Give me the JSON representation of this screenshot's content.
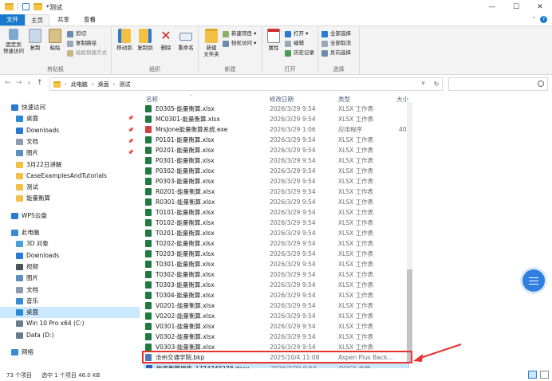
{
  "window": {
    "title": "测试"
  },
  "ribbon_tabs": [
    "文件",
    "主页",
    "共享",
    "查看"
  ],
  "ribbon": {
    "clipboard": {
      "label": "剪贴板",
      "pin": "固定到\n快速访问",
      "copy": "复制",
      "paste": "粘贴",
      "cut": "剪切",
      "copy_path": "复制路径",
      "paste_shortcut": "粘贴快捷方式"
    },
    "organize": {
      "label": "组织",
      "move_to": "移动到",
      "copy_to": "复制到",
      "delete": "删除",
      "rename": "重命名"
    },
    "new": {
      "label": "新建",
      "new_folder": "新建\n文件夹",
      "new_item": "新建项目 ▾",
      "easy_access": "轻松访问 ▾"
    },
    "open": {
      "label": "打开",
      "properties": "属性",
      "open": "打开 ▾",
      "edit": "编辑",
      "history": "历史记录"
    },
    "select": {
      "label": "选择",
      "select_all": "全部选择",
      "select_none": "全部取消",
      "invert": "反向选择"
    }
  },
  "address": {
    "parts": [
      "此电脑",
      "桌面",
      "测试"
    ]
  },
  "search": {
    "placeholder": ""
  },
  "nav": [
    {
      "label": "快速访问",
      "icon": "star-icon",
      "color": "#2a7ad5",
      "pinned": false,
      "level": 0
    },
    {
      "label": "桌面",
      "icon": "desktop-icon",
      "color": "#2a8ad5",
      "pinned": true,
      "level": 1
    },
    {
      "label": "Downloads",
      "icon": "download-icon",
      "color": "#2a7ad5",
      "pinned": true,
      "level": 1
    },
    {
      "label": "文档",
      "icon": "document-icon",
      "color": "#8a9bb0",
      "pinned": true,
      "level": 1
    },
    {
      "label": "图片",
      "icon": "picture-icon",
      "color": "#5a8fc0",
      "pinned": true,
      "level": 1
    },
    {
      "label": "3月22日讲解",
      "icon": "folder-icon",
      "color": "#f2c045",
      "pinned": false,
      "level": 1
    },
    {
      "label": "CaseExamplesAndTutorials",
      "icon": "folder-icon",
      "color": "#f2c045",
      "pinned": false,
      "level": 1
    },
    {
      "label": "测试",
      "icon": "folder-icon",
      "color": "#f2c045",
      "pinned": false,
      "level": 1
    },
    {
      "label": "能量衡算",
      "icon": "folder-icon",
      "color": "#f2c045",
      "pinned": false,
      "level": 1
    },
    {
      "label": "",
      "spacer": true
    },
    {
      "label": "WPS云盘",
      "icon": "cloud-icon",
      "color": "#2a7ad5",
      "pinned": false,
      "level": 0
    },
    {
      "label": "",
      "spacer": true
    },
    {
      "label": "此电脑",
      "icon": "computer-icon",
      "color": "#3a8ad5",
      "pinned": false,
      "level": 0
    },
    {
      "label": "3D 对象",
      "icon": "3d-objects-icon",
      "color": "#4aa0d8",
      "pinned": false,
      "level": 1
    },
    {
      "label": "Downloads",
      "icon": "download-icon",
      "color": "#2a7ad5",
      "pinned": false,
      "level": 1
    },
    {
      "label": "视频",
      "icon": "video-icon",
      "color": "#4a5060",
      "pinned": false,
      "level": 1
    },
    {
      "label": "图片",
      "icon": "picture-icon",
      "color": "#5a8fc0",
      "pinned": false,
      "level": 1
    },
    {
      "label": "文档",
      "icon": "document-icon",
      "color": "#8a9bb0",
      "pinned": false,
      "level": 1
    },
    {
      "label": "音乐",
      "icon": "music-icon",
      "color": "#3a8ad5",
      "pinned": false,
      "level": 1
    },
    {
      "label": "桌面",
      "icon": "desktop-icon",
      "color": "#2a8ad5",
      "pinned": false,
      "level": 1,
      "selected": true
    },
    {
      "label": "Win 10 Pro x64 (C:)",
      "icon": "drive-icon",
      "color": "#6a7a8a",
      "pinned": false,
      "level": 1
    },
    {
      "label": "Data (D:)",
      "icon": "drive-icon",
      "color": "#6a7a8a",
      "pinned": false,
      "level": 1
    },
    {
      "label": "",
      "spacer": true
    },
    {
      "label": "网络",
      "icon": "network-icon",
      "color": "#3a8ad5",
      "pinned": false,
      "level": 0
    }
  ],
  "columns": {
    "name": "名称",
    "date": "修改日期",
    "type": "类型",
    "size": "大小"
  },
  "files": [
    {
      "name": "E0305-能量衡算.xlsx",
      "date": "2026/3/29 9:54",
      "type": "XLSX 工作表",
      "size": "",
      "icon": "xlsx-icon"
    },
    {
      "name": "MC0301-能量衡算.xlsx",
      "date": "2026/3/29 9:54",
      "type": "XLSX 工作表",
      "size": "",
      "icon": "xlsx-icon"
    },
    {
      "name": "MrsJone能量衡算系统.exe",
      "date": "2026/3/29 1:06",
      "type": "应用程序",
      "size": "40,",
      "icon": "exe-icon"
    },
    {
      "name": "P0101-能量衡算.xlsx",
      "date": "2026/3/29 9:54",
      "type": "XLSX 工作表",
      "size": "",
      "icon": "xlsx-icon"
    },
    {
      "name": "P0201-能量衡算.xlsx",
      "date": "2026/3/29 9:54",
      "type": "XLSX 工作表",
      "size": "",
      "icon": "xlsx-icon"
    },
    {
      "name": "P0301-能量衡算.xlsx",
      "date": "2026/3/29 9:54",
      "type": "XLSX 工作表",
      "size": "",
      "icon": "xlsx-icon"
    },
    {
      "name": "P0302-能量衡算.xlsx",
      "date": "2026/3/29 9:54",
      "type": "XLSX 工作表",
      "size": "",
      "icon": "xlsx-icon"
    },
    {
      "name": "P0303-能量衡算.xlsx",
      "date": "2026/3/29 9:54",
      "type": "XLSX 工作表",
      "size": "",
      "icon": "xlsx-icon"
    },
    {
      "name": "R0201-能量衡算.xlsx",
      "date": "2026/3/29 9:54",
      "type": "XLSX 工作表",
      "size": "",
      "icon": "xlsx-icon"
    },
    {
      "name": "R0301-能量衡算.xlsx",
      "date": "2026/3/29 9:54",
      "type": "XLSX 工作表",
      "size": "",
      "icon": "xlsx-icon"
    },
    {
      "name": "T0101-能量衡算.xlsx",
      "date": "2026/3/29 9:54",
      "type": "XLSX 工作表",
      "size": "",
      "icon": "xlsx-icon"
    },
    {
      "name": "T0102-能量衡算.xlsx",
      "date": "2026/3/29 9:54",
      "type": "XLSX 工作表",
      "size": "",
      "icon": "xlsx-icon"
    },
    {
      "name": "T0201-能量衡算.xlsx",
      "date": "2026/3/29 9:54",
      "type": "XLSX 工作表",
      "size": "",
      "icon": "xlsx-icon"
    },
    {
      "name": "T0202-能量衡算.xlsx",
      "date": "2026/3/29 9:54",
      "type": "XLSX 工作表",
      "size": "",
      "icon": "xlsx-icon"
    },
    {
      "name": "T0203-能量衡算.xlsx",
      "date": "2026/3/29 9:54",
      "type": "XLSX 工作表",
      "size": "",
      "icon": "xlsx-icon"
    },
    {
      "name": "T0301-能量衡算.xlsx",
      "date": "2026/3/29 9:54",
      "type": "XLSX 工作表",
      "size": "",
      "icon": "xlsx-icon"
    },
    {
      "name": "T0302-能量衡算.xlsx",
      "date": "2026/3/29 9:54",
      "type": "XLSX 工作表",
      "size": "",
      "icon": "xlsx-icon"
    },
    {
      "name": "T0303-能量衡算.xlsx",
      "date": "2026/3/29 9:54",
      "type": "XLSX 工作表",
      "size": "",
      "icon": "xlsx-icon"
    },
    {
      "name": "T0304-能量衡算.xlsx",
      "date": "2026/3/29 9:54",
      "type": "XLSX 工作表",
      "size": "",
      "icon": "xlsx-icon"
    },
    {
      "name": "V0201-能量衡算.xlsx",
      "date": "2026/3/29 9:54",
      "type": "XLSX 工作表",
      "size": "",
      "icon": "xlsx-icon"
    },
    {
      "name": "V0202-能量衡算.xlsx",
      "date": "2026/3/29 9:54",
      "type": "XLSX 工作表",
      "size": "",
      "icon": "xlsx-icon"
    },
    {
      "name": "V0301-能量衡算.xlsx",
      "date": "2026/3/29 9:54",
      "type": "XLSX 工作表",
      "size": "",
      "icon": "xlsx-icon"
    },
    {
      "name": "V0302-能量衡算.xlsx",
      "date": "2026/3/29 9:54",
      "type": "XLSX 工作表",
      "size": "",
      "icon": "xlsx-icon"
    },
    {
      "name": "V0303-能量衡算.xlsx",
      "date": "2026/3/29 9:54",
      "type": "XLSX 工作表",
      "size": "",
      "icon": "xlsx-icon"
    },
    {
      "name": "沧州交通学院.bkp",
      "date": "2025/10/4 11:08",
      "type": "Aspen Plus Back...",
      "size": "",
      "icon": "bkp-icon"
    },
    {
      "name": "能量衡算报告_1774749278.docx",
      "date": "2026/3/29 9:54",
      "type": "DOCX 文档",
      "size": "",
      "icon": "docx-icon",
      "selected": true
    }
  ],
  "status": {
    "count": "73 个项目",
    "selected": "选中 1 个项目  46.0 KB"
  },
  "colors": {
    "accent": "#1979ca",
    "xlsx": "#1e7a3e",
    "docx": "#2b5fb4",
    "exe": "#d04040",
    "highlight": "#e8322f"
  }
}
